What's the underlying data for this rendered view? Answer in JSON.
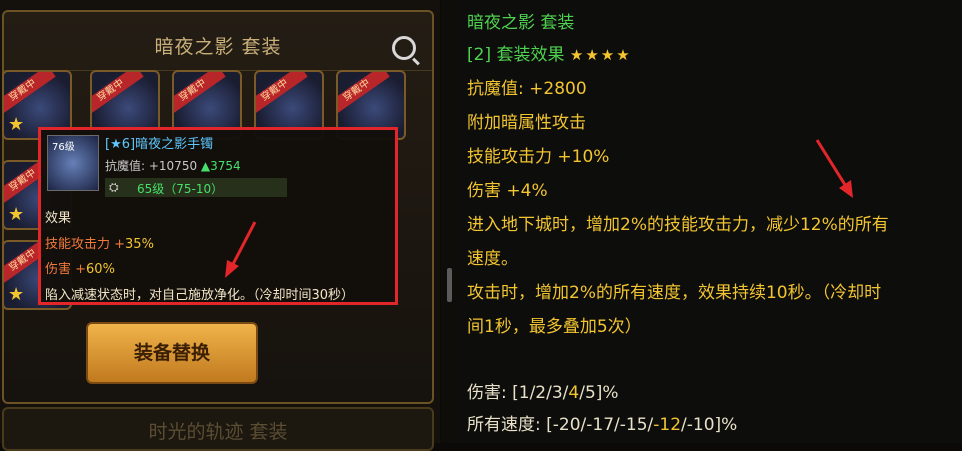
{
  "left_panel": {
    "title": "暗夜之影 套装",
    "slots": [
      {
        "tag": "穿戴中"
      },
      {
        "tag": "穿戴中"
      },
      {
        "tag": "穿戴中"
      },
      {
        "tag": "穿戴中"
      },
      {
        "tag": "穿戴中"
      },
      {
        "tag": "穿戴中"
      },
      {
        "tag": "穿戴中"
      }
    ],
    "button_label": "装备替换",
    "next_title": "时光的轨迹 套装"
  },
  "tooltip": {
    "icon_level": "76级",
    "name": "[★6]暗夜之影手镯",
    "stat_label": "抗魔值: +10750",
    "stat_up": "▲3754",
    "gear_glyph": "⛭",
    "level_text": "65级（75-10）",
    "effect_heading": "效果",
    "line1_label": "技能攻击力 +",
    "line1_value": "35%",
    "line2_label": "伤害 +",
    "line2_value": "60%",
    "desc": "陷入减速状态时，对自己施放净化。（冷却时间30秒）"
  },
  "right_panel": {
    "title": "暗夜之影  套装",
    "set_label": "[2] 套装效果",
    "stars": "★★★★",
    "lines": [
      "抗魔值: +2800",
      "附加暗属性攻击",
      "技能攻击力 +10%",
      "伤害 +4%",
      "进入地下城时，增加2%的技能攻击力，减少12%的所有",
      "速度。",
      "攻击时，增加2%的所有速度，效果持续10秒。（冷却时",
      "间1秒，最多叠加5次）"
    ],
    "damage_label": "伤害: [1/2/3/",
    "damage_hl": "4",
    "damage_rest": "/5]%",
    "speed_label": "所有速度: [-20/-17/-15/",
    "speed_hl": "-12",
    "speed_rest": "/-10]%"
  },
  "colors": {
    "accent_green": "#4fd24f",
    "accent_gold": "#f2c531",
    "tooltip_border": "#e2262a"
  }
}
